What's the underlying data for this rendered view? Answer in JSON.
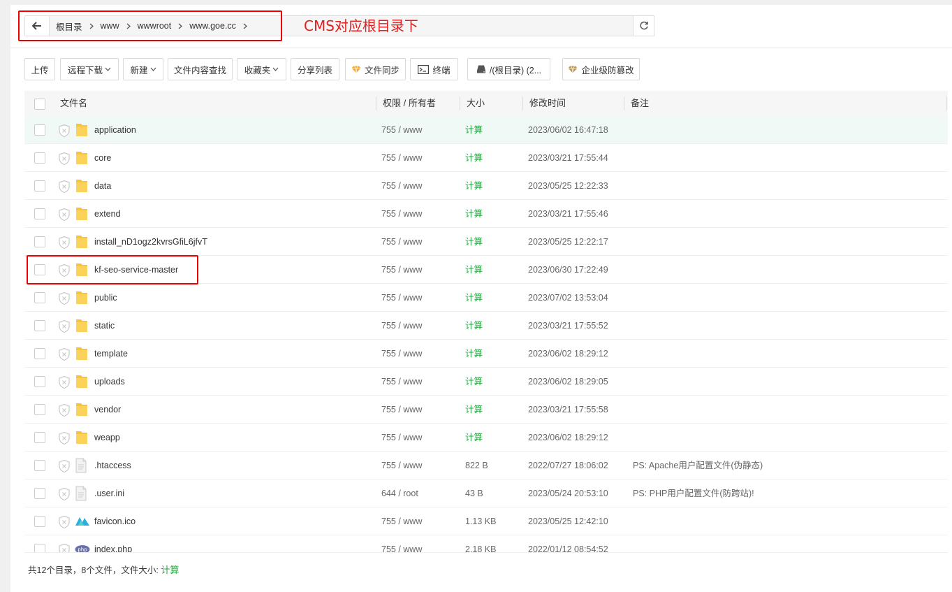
{
  "breadcrumb": [
    "根目录",
    "www",
    "wwwroot",
    "www.goe.cc"
  ],
  "annotation": "CMS对应根目录下",
  "toolbar": {
    "upload": "上传",
    "remote_download": "远程下载",
    "new": "新建",
    "search_content": "文件内容查找",
    "favorites": "收藏夹",
    "share_list": "分享列表",
    "file_sync": "文件同步",
    "terminal": "终端",
    "disk": "/(根目录) (2...",
    "tamper_protect": "企业级防篡改"
  },
  "columns": {
    "name": "文件名",
    "perm": "权限 / 所有者",
    "size": "大小",
    "mtime": "修改时间",
    "note": "备注"
  },
  "rows": [
    {
      "name": "application",
      "type": "folder",
      "perm": "755 / www",
      "size": "计算",
      "mtime": "2023/06/02 16:47:18",
      "note": ""
    },
    {
      "name": "core",
      "type": "folder",
      "perm": "755 / www",
      "size": "计算",
      "mtime": "2023/03/21 17:55:44",
      "note": ""
    },
    {
      "name": "data",
      "type": "folder",
      "perm": "755 / www",
      "size": "计算",
      "mtime": "2023/05/25 12:22:33",
      "note": ""
    },
    {
      "name": "extend",
      "type": "folder",
      "perm": "755 / www",
      "size": "计算",
      "mtime": "2023/03/21 17:55:46",
      "note": ""
    },
    {
      "name": "install_nD1ogz2kvrsGfiL6jfvT",
      "type": "folder",
      "perm": "755 / www",
      "size": "计算",
      "mtime": "2023/05/25 12:22:17",
      "note": ""
    },
    {
      "name": "kf-seo-service-master",
      "type": "folder",
      "perm": "755 / www",
      "size": "计算",
      "mtime": "2023/06/30 17:22:49",
      "note": ""
    },
    {
      "name": "public",
      "type": "folder",
      "perm": "755 / www",
      "size": "计算",
      "mtime": "2023/07/02 13:53:04",
      "note": ""
    },
    {
      "name": "static",
      "type": "folder",
      "perm": "755 / www",
      "size": "计算",
      "mtime": "2023/03/21 17:55:52",
      "note": ""
    },
    {
      "name": "template",
      "type": "folder",
      "perm": "755 / www",
      "size": "计算",
      "mtime": "2023/06/02 18:29:12",
      "note": ""
    },
    {
      "name": "uploads",
      "type": "folder",
      "perm": "755 / www",
      "size": "计算",
      "mtime": "2023/06/02 18:29:05",
      "note": ""
    },
    {
      "name": "vendor",
      "type": "folder",
      "perm": "755 / www",
      "size": "计算",
      "mtime": "2023/03/21 17:55:58",
      "note": ""
    },
    {
      "name": "weapp",
      "type": "folder",
      "perm": "755 / www",
      "size": "计算",
      "mtime": "2023/06/02 18:29:12",
      "note": ""
    },
    {
      "name": ".htaccess",
      "type": "file",
      "perm": "755 / www",
      "size": "822 B",
      "mtime": "2022/07/27 18:06:02",
      "note": "PS: Apache用户配置文件(伪静态)"
    },
    {
      "name": ".user.ini",
      "type": "file",
      "perm": "644 / root",
      "size": "43 B",
      "mtime": "2023/05/24 20:53:10",
      "note": "PS: PHP用户配置文件(防跨站)!"
    },
    {
      "name": "favicon.ico",
      "type": "ico",
      "perm": "755 / www",
      "size": "1.13 KB",
      "mtime": "2023/05/25 12:42:10",
      "note": ""
    },
    {
      "name": "index.php",
      "type": "php",
      "perm": "755 / www",
      "size": "2.18 KB",
      "mtime": "2022/01/12 08:54:52",
      "note": ""
    }
  ],
  "footer": {
    "summary": "共12个目录，8个文件，文件大小:",
    "calc": "计算"
  },
  "colors": {
    "accent_green": "#20a53a",
    "annotation_red": "#e02020",
    "highlight_row": "#f1f9f6"
  }
}
